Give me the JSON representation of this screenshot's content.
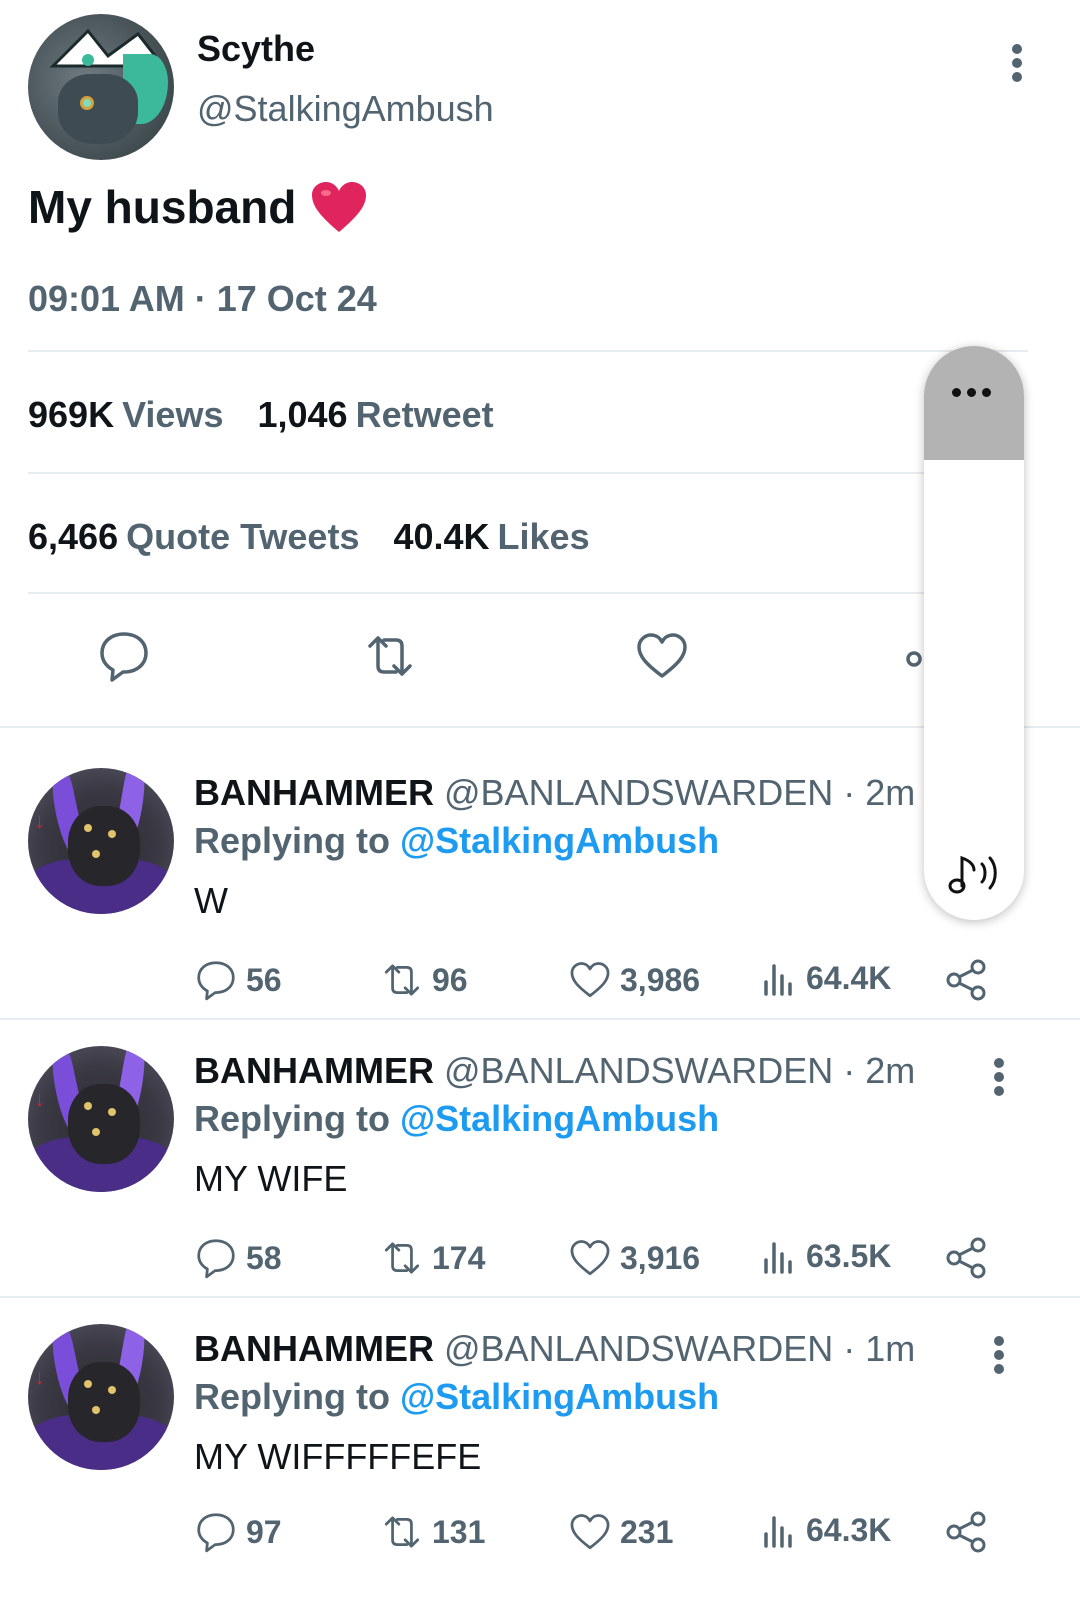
{
  "main_tweet": {
    "display_name": "Scythe",
    "handle": "@StalkingAmbush",
    "text": "My husband",
    "emoji": "red-heart",
    "timestamp": "09:01 AM · 17 Oct 24",
    "stats": {
      "views_count": "969K",
      "views_label": "Views",
      "retweet_count": "1,046",
      "retweet_label": "Retweet",
      "quote_count": "6,466",
      "quote_label": "Quote Tweets",
      "likes_count": "40.4K",
      "likes_label": "Likes"
    }
  },
  "replies": [
    {
      "display_name": "BANHAMMER",
      "handle": "@BANLANDSWARDEN · 2m",
      "replying_prefix": "Replying to",
      "replying_to": "@StalkingAmbush",
      "text": "W",
      "comments": "56",
      "retweets": "96",
      "likes": "3,986",
      "views": "64.4K"
    },
    {
      "display_name": "BANHAMMER",
      "handle": "@BANLANDSWARDEN · 2m",
      "replying_prefix": "Replying to",
      "replying_to": "@StalkingAmbush",
      "text": "MY WIFE",
      "comments": "58",
      "retweets": "174",
      "likes": "3,916",
      "views": "63.5K"
    },
    {
      "display_name": "BANHAMMER",
      "handle": "@BANLANDSWARDEN · 1m",
      "replying_prefix": "Replying to",
      "replying_to": "@StalkingAmbush",
      "text": "MY WIFFFFFEFE",
      "comments": "97",
      "retweets": "131",
      "likes": "231",
      "views": "64.3K"
    }
  ],
  "colors": {
    "accent": "#1d9bf0",
    "secondary_text": "#536471",
    "heart_emoji": "#e0245e"
  }
}
